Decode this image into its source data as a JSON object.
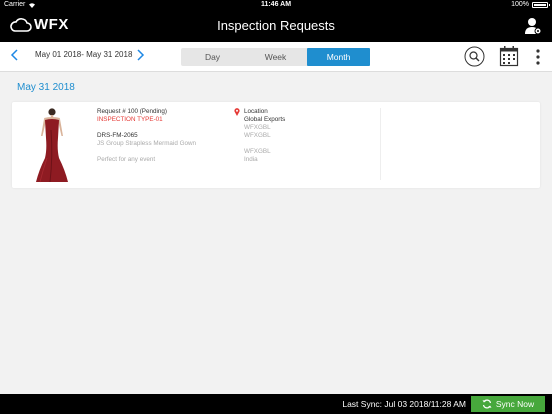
{
  "status_bar": {
    "carrier": "Carrier",
    "time": "11:46 AM",
    "battery": "100%"
  },
  "header": {
    "logo_text": "WFX",
    "title": "Inspection Requests"
  },
  "toolbar": {
    "date_range": "May 01 2018- May 31 2018",
    "segments": [
      "Day",
      "Week",
      "Month"
    ],
    "active_segment": "Month"
  },
  "section_date": "May 31 2018",
  "request": {
    "number_text": "Request #  100 (Pending)",
    "type": "INSPECTION TYPE-01",
    "style_code": "DRS-FM-2065",
    "style_name": "JS Group Strapless Mermaid Gown",
    "description": "Perfect for any event",
    "location_label": "Location",
    "location_name": "Global Exports",
    "loc_code_1": "WFXGBL",
    "loc_code_2": "WFXGBL",
    "loc_code_3": "WFXGBL",
    "country": "India"
  },
  "footer": {
    "last_sync": "Last Sync: Jul 03 2018/11:28 AM",
    "sync_label": "Sync Now"
  },
  "colors": {
    "accent": "#1f8ecf",
    "pending_type": "#e53935",
    "sync_button": "#47a83c"
  }
}
